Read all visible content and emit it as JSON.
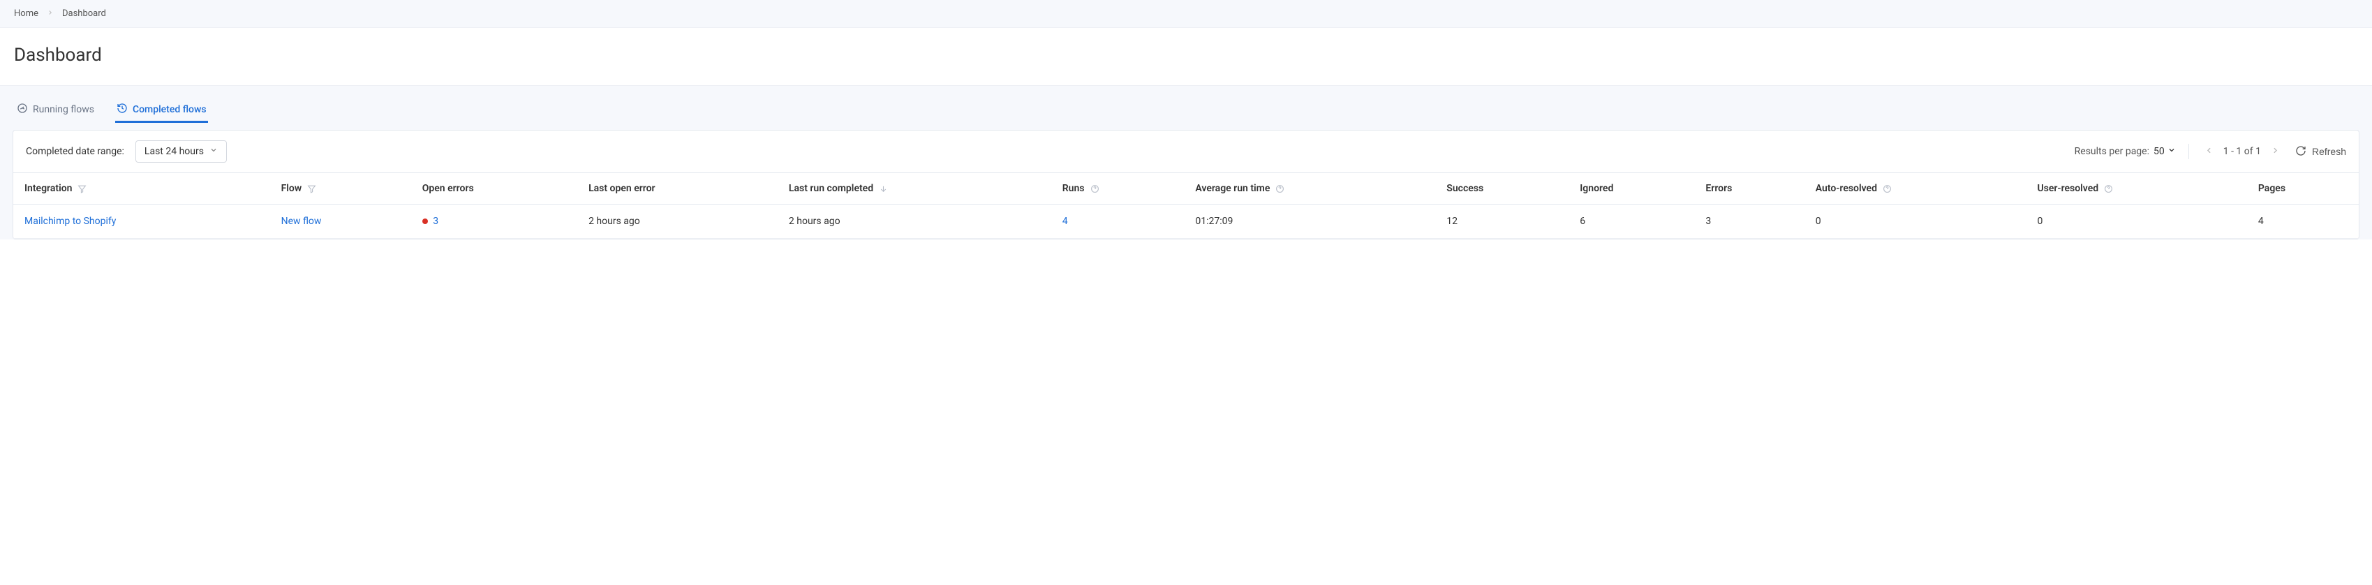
{
  "breadcrumb": {
    "home": "Home",
    "current": "Dashboard"
  },
  "page_title": "Dashboard",
  "tabs": {
    "running": "Running flows",
    "completed": "Completed flows"
  },
  "toolbar": {
    "range_label": "Completed date range:",
    "range_value": "Last 24 hours",
    "results_per_page_label": "Results per page:",
    "results_per_page_value": "50",
    "page_range": "1 - 1 of 1",
    "refresh": "Refresh"
  },
  "columns": {
    "integration": "Integration",
    "flow": "Flow",
    "open_errors": "Open errors",
    "last_open_error": "Last open error",
    "last_run_completed": "Last run completed",
    "runs": "Runs",
    "avg_run_time": "Average run time",
    "success": "Success",
    "ignored": "Ignored",
    "errors": "Errors",
    "auto_resolved": "Auto-resolved",
    "user_resolved": "User-resolved",
    "pages": "Pages"
  },
  "rows": [
    {
      "integration": "Mailchimp to Shopify",
      "flow": "New flow",
      "open_errors": "3",
      "last_open_error": "2 hours ago",
      "last_run_completed": "2 hours ago",
      "runs": "4",
      "avg_run_time": "01:27:09",
      "success": "12",
      "ignored": "6",
      "errors": "3",
      "auto_resolved": "0",
      "user_resolved": "0",
      "pages": "4"
    }
  ]
}
